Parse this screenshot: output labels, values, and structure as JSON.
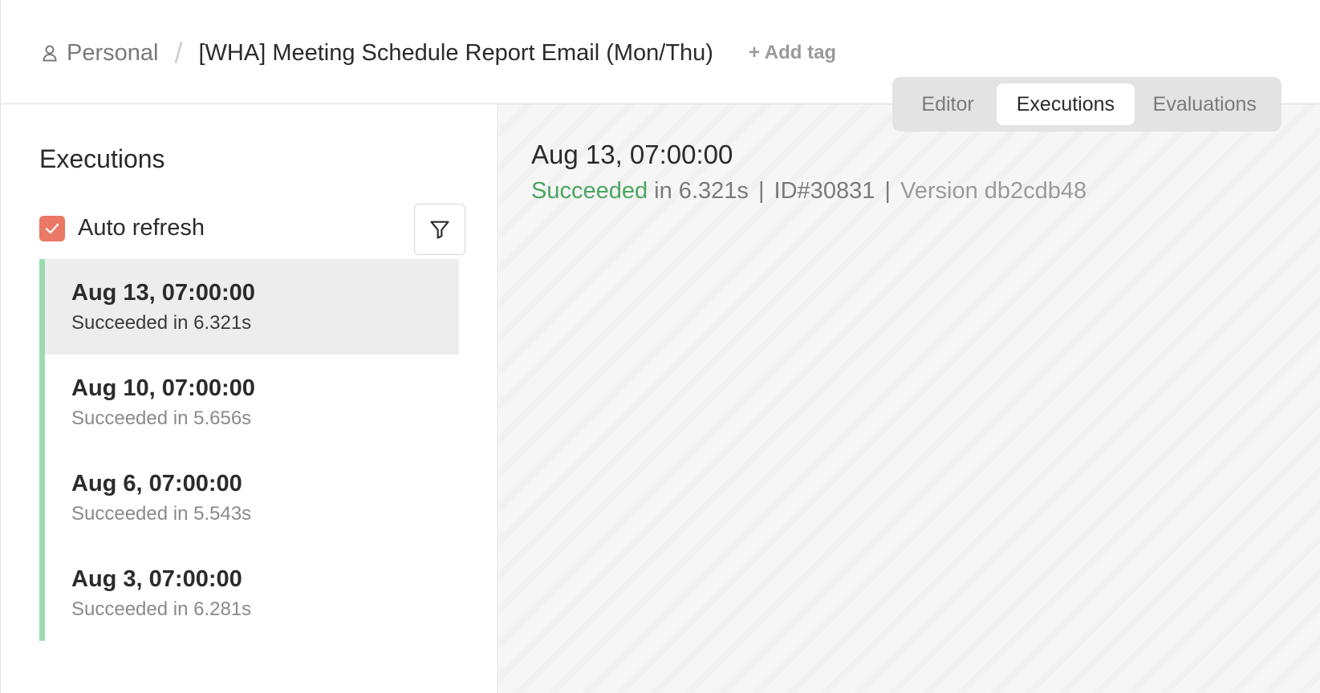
{
  "header": {
    "breadcrumb_personal": "Personal",
    "breadcrumb_separator": "/",
    "workflow_title": "[WHA] Meeting Schedule Report Email (Mon/Thu)",
    "add_tag_label": "+ Add tag"
  },
  "tabs": [
    {
      "label": "Editor",
      "active": false
    },
    {
      "label": "Executions",
      "active": true
    },
    {
      "label": "Evaluations",
      "active": false
    }
  ],
  "sidebar": {
    "title": "Executions",
    "auto_refresh_label": "Auto refresh",
    "auto_refresh_checked": true,
    "executions": [
      {
        "date": "Aug 13, 07:00:00",
        "status": "Succeeded in 6.321s",
        "selected": true
      },
      {
        "date": "Aug 10, 07:00:00",
        "status": "Succeeded in 5.656s",
        "selected": false
      },
      {
        "date": "Aug 6, 07:00:00",
        "status": "Succeeded in 5.543s",
        "selected": false
      },
      {
        "date": "Aug 3, 07:00:00",
        "status": "Succeeded in 6.281s",
        "selected": false
      }
    ]
  },
  "detail": {
    "date": "Aug 13, 07:00:00",
    "status_word": "Succeeded",
    "duration_text": " in 6.321s ",
    "id_text": " ID#30831 ",
    "version_text": " Version db2cdb48",
    "pipe": "|"
  },
  "colors": {
    "success": "#4aa561",
    "success_bar": "#9bdcb0",
    "checkbox": "#ea7865"
  },
  "icons": [
    "person-icon",
    "filter-icon",
    "check-icon"
  ]
}
